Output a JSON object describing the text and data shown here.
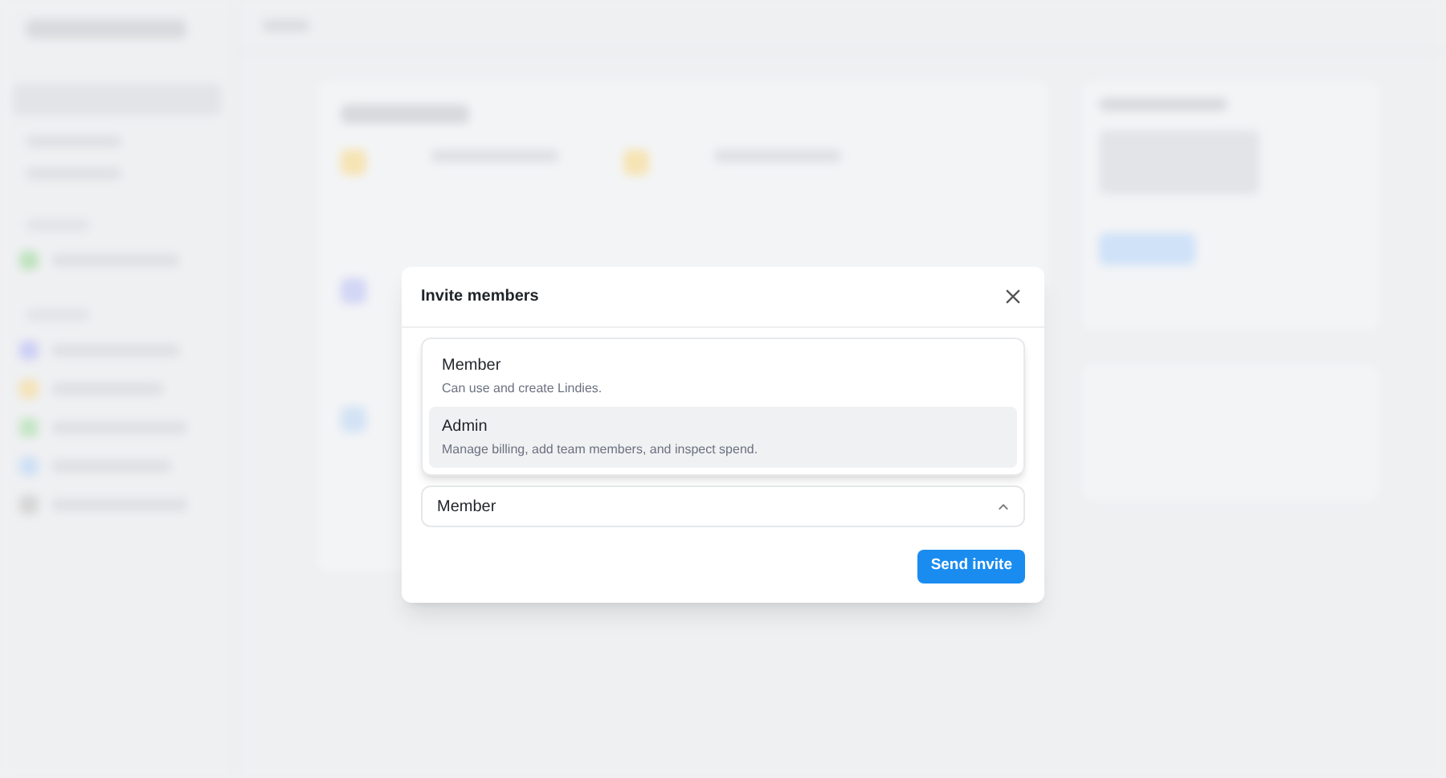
{
  "dialog": {
    "title": "Invite members",
    "role_menu": [
      {
        "label": "Member",
        "description": "Can use and create Lindies.",
        "highlighted": false
      },
      {
        "label": "Admin",
        "description": "Manage billing, add team members, and inspect spend.",
        "highlighted": true
      }
    ],
    "role_select": {
      "value": "Member",
      "expanded": true
    },
    "buttons": [
      "Send invite"
    ]
  }
}
